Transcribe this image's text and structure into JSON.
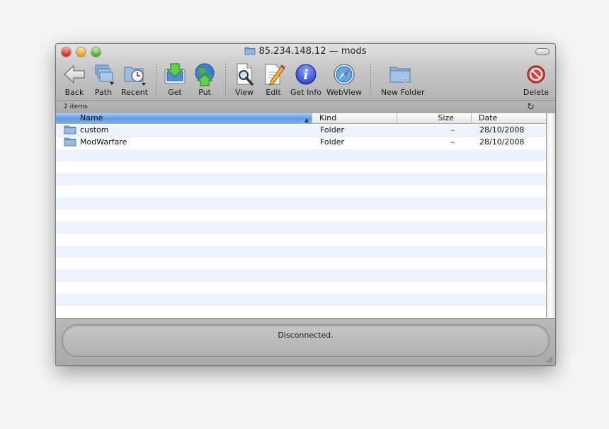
{
  "window": {
    "title": "85.234.148.12 — mods"
  },
  "toolbar": {
    "back": "Back",
    "path": "Path",
    "recent": "Recent",
    "get": "Get",
    "put": "Put",
    "view": "View",
    "edit": "Edit",
    "get_info": "Get Info",
    "webview": "WebView",
    "new_folder": "New Folder",
    "delete": "Delete"
  },
  "status": {
    "item_count": "2 items"
  },
  "table": {
    "columns": [
      "Name",
      "Kind",
      "Size",
      "Date"
    ],
    "rows": [
      {
        "name": "custom",
        "kind": "Folder",
        "size": "–",
        "date": "28/10/2008"
      },
      {
        "name": "ModWarfare",
        "kind": "Folder",
        "size": "–",
        "date": "28/10/2008"
      }
    ]
  },
  "connection": {
    "status": "Disconnected."
  },
  "colors": {
    "selected_header": "#5e9ae6",
    "alt_row": "#edf3fe"
  },
  "icons": {
    "back": "arrow-left-icon",
    "path": "folder-stack-icon",
    "recent": "clock-folder-icon",
    "get": "download-icon",
    "put": "upload-globe-icon",
    "view": "magnifier-doc-icon",
    "edit": "pencil-doc-icon",
    "get_info": "info-icon",
    "webview": "compass-icon",
    "new_folder": "new-folder-icon",
    "delete": "no-entry-icon"
  }
}
